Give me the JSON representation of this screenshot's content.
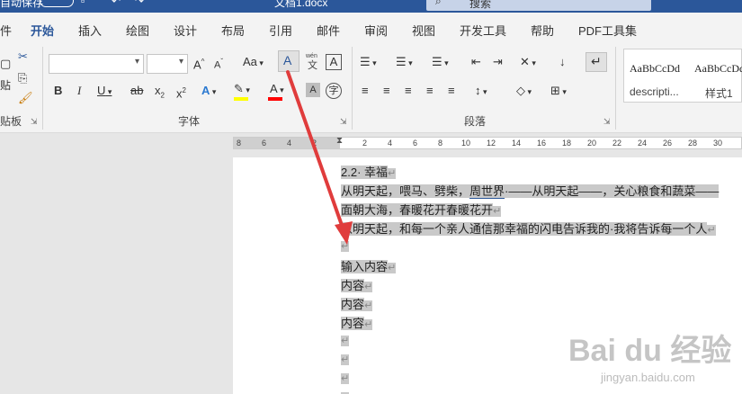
{
  "titlebar": {
    "left_text": "自动保存",
    "document_title": "文档1.docx",
    "search_placeholder": "搜索"
  },
  "tabs": [
    {
      "label": "件"
    },
    {
      "label": "开始"
    },
    {
      "label": "插入"
    },
    {
      "label": "绘图"
    },
    {
      "label": "设计"
    },
    {
      "label": "布局"
    },
    {
      "label": "引用"
    },
    {
      "label": "邮件"
    },
    {
      "label": "审阅"
    },
    {
      "label": "视图"
    },
    {
      "label": "开发工具"
    },
    {
      "label": "帮助"
    },
    {
      "label": "PDF工具集"
    }
  ],
  "ribbon": {
    "clipboard_label": "贴板",
    "font_label": "字体",
    "paragraph_label": "段落",
    "paste_label": "贴",
    "font_size_increase": "A",
    "font_size_decrease": "A",
    "change_case": "Aa",
    "bold": "B",
    "italic": "I",
    "underline": "U",
    "strikethrough": "ab",
    "subscript": "x",
    "superscript": "x",
    "phonetic_top": "wén",
    "phonetic_bottom": "文",
    "enclose_char": "字",
    "char_border": "A",
    "styles": [
      {
        "sample": "AaBbCcDd",
        "name": "descripti..."
      },
      {
        "sample": "AaBbCcDd",
        "name": "样式1"
      }
    ]
  },
  "ruler": {
    "left_numbers": [
      "8",
      "6",
      "4",
      "2"
    ],
    "right_numbers": [
      "2",
      "4",
      "6",
      "8",
      "10",
      "12",
      "14",
      "16",
      "18",
      "20",
      "22",
      "24",
      "26",
      "28",
      "30"
    ]
  },
  "document": {
    "line1": "2.2· 幸福",
    "line2_a": "从明天起，喂马、劈柴，",
    "line2_link": "周世界",
    "line2_b": "·——从明天起——，关心粮食和蔬菜——",
    "line3": "面朝大海，春暖花开春暖花开",
    "line4": "从明天起，和每一个亲人通信那幸福的闪电告诉我的·我将告诉每一个人",
    "line6": "输入内容",
    "line7": "内容",
    "line8": "内容",
    "line9": "内容"
  },
  "watermark": {
    "main": "Bai du 经验",
    "sub": "jingyan.baidu.com"
  },
  "colors": {
    "accent": "#2b579a",
    "highlight": "#c9c9c9",
    "arrow": "#e03c3c",
    "text_highlight_yellow": "#ffff00",
    "font_color_red": "#ff0000"
  }
}
